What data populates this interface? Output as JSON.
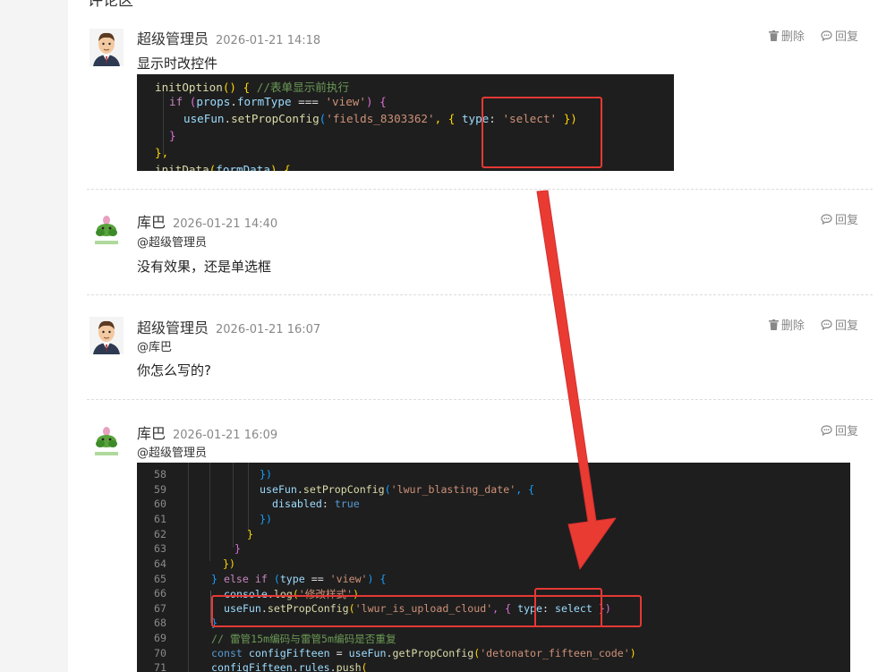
{
  "heading": "评论区",
  "colors": {
    "accent_red": "#e53935",
    "code_bg": "#1e1e1e",
    "muted": "#888888"
  },
  "actions": {
    "delete": "删除",
    "reply": "回复"
  },
  "comments": [
    {
      "author": "超级管理员",
      "time": "2026-01-21 14:18",
      "text": "显示时改控件",
      "avatar": "admin-avatar"
    },
    {
      "author": "库巴",
      "time": "2026-01-21 14:40",
      "mention": "@超级管理员",
      "text": "没有效果，还是单选框",
      "avatar": "kuba-avatar"
    },
    {
      "author": "超级管理员",
      "time": "2026-01-21 16:07",
      "mention": "@库巴",
      "text": "你怎么写的?",
      "avatar": "admin-avatar"
    },
    {
      "author": "库巴",
      "time": "2026-01-21 16:09",
      "mention": "@超级管理员",
      "avatar": "kuba-avatar"
    }
  ],
  "code1": {
    "l1a": "initOption",
    "l1b": "() { ",
    "l1c": "//表单显示前执行",
    "l2a": "if",
    "l2b": "(",
    "l2c": "props",
    "l2d": ".",
    "l2e": "formType",
    "l2f": " === ",
    "l2g": "'view'",
    "l2h": ") {",
    "l3a": "useFun",
    "l3b": ".",
    "l3c": "setPropConfig",
    "l3d": "(",
    "l3e": "'fields_8303362'",
    "l3f": ", { ",
    "l3g": "type",
    "l3h": ": ",
    "l3i": "'select'",
    "l3j": " })",
    "l4": "}",
    "l5": "},",
    "l6a": "initData",
    "l6b": "(",
    "l6c": "formData",
    "l6d": ") {"
  },
  "code2": {
    "nums": [
      "58",
      "59",
      "60",
      "61",
      "62",
      "63",
      "64",
      "65",
      "66",
      "67",
      "68",
      "69",
      "70",
      "71"
    ],
    "l58": "})",
    "l59a": "useFun",
    "l59b": ".",
    "l59c": "setPropConfig",
    "l59d": "(",
    "l59e": "'lwur_blasting_date'",
    "l59f": ", {",
    "l60a": "disabled",
    "l60b": ": ",
    "l60c": "true",
    "l61": "})",
    "l62": "}",
    "l63": "}",
    "l64": "})",
    "l65a": "} ",
    "l65b": "else if",
    "l65c": " (",
    "l65d": "type",
    "l65e": " == ",
    "l65f": "'view'",
    "l65g": ") {",
    "l66a": "console",
    "l66b": ".",
    "l66c": "log",
    "l66d": "(",
    "l66e": "'修改样式'",
    "l66f": ")",
    "l67a": "useFun",
    "l67b": ".",
    "l67c": "setPropConfig",
    "l67d": "(",
    "l67e": "'lwur_is_upload_cloud'",
    "l67f": ", { ",
    "l67g": "type",
    "l67h": ": ",
    "l67i": "select",
    "l67j": " })",
    "l68": "}",
    "l69": "// 雷管15m编码与雷管5m编码是否重复",
    "l70a": "const",
    "l70b": " configFifteen",
    "l70c": " = ",
    "l70d": "useFun",
    "l70e": ".",
    "l70f": "getPropConfig",
    "l70g": "(",
    "l70h": "'detonator_fifteen_code'",
    "l70i": ")",
    "l71a": "configFifteen",
    "l71b": ".",
    "l71c": "rules",
    "l71d": ".",
    "l71e": "push",
    "l71f": "("
  }
}
